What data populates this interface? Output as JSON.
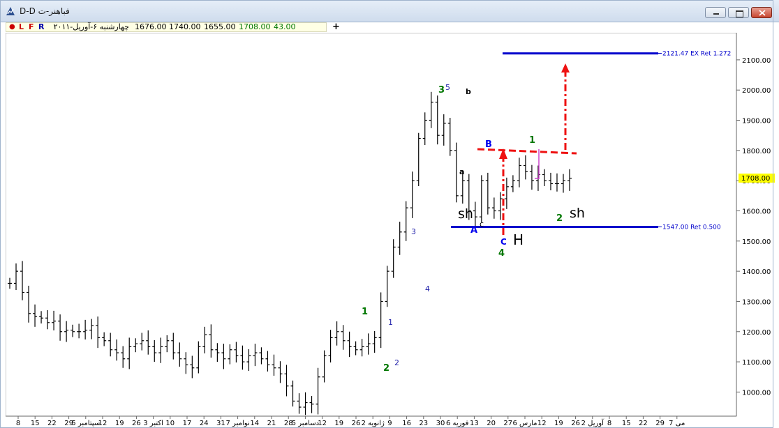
{
  "window": {
    "title": "D-D فباهنر-ت",
    "minimize_label": "minimize",
    "maximize_label": "maximize",
    "close_label": "close"
  },
  "infobar": {
    "dot": "●",
    "btn_l": "L",
    "btn_f": "F",
    "btn_r": "R",
    "date": "چهارشنبه ۶-آوریل-۲۰۱۱",
    "open": "1676.00",
    "high": "1740.00",
    "low": "1655.00",
    "close": "1708.00",
    "change": "43.00",
    "add": "+"
  },
  "chart_data": {
    "type": "ohlc",
    "y_axis": {
      "position": "right",
      "range": [
        950,
        2200
      ],
      "ticks": [
        "1000.00",
        "1100.00",
        "1200.00",
        "1300.00",
        "1400.00",
        "1500.00",
        "1600.00",
        "1700.00",
        "1800.00",
        "1900.00",
        "2000.00",
        "2100.00"
      ],
      "last_value": "1708.00"
    },
    "x_axis": {
      "labels": [
        "8",
        "15",
        "22",
        "29",
        "سپتامبر 5",
        "12",
        "19",
        "26",
        "اکتبر 3",
        "10",
        "17",
        "24",
        "31",
        "نوامبر 7",
        "14",
        "21",
        "28",
        "دسامبر 5",
        "12",
        "19",
        "26",
        "ژانویه 2",
        "9",
        "16",
        "23",
        "30",
        "فوریه 6",
        "13",
        "20",
        "27",
        "مارس 6",
        "12",
        "19",
        "26",
        "آوریل 2",
        "8",
        "15",
        "22",
        "29",
        "می 7"
      ]
    },
    "close_series": [
      1360,
      1400,
      1330,
      1260,
      1250,
      1245,
      1230,
      1235,
      1200,
      1205,
      1200,
      1200,
      1205,
      1220,
      1180,
      1170,
      1140,
      1130,
      1110,
      1150,
      1160,
      1170,
      1150,
      1130,
      1150,
      1170,
      1130,
      1110,
      1090,
      1080,
      1150,
      1190,
      1140,
      1130,
      1110,
      1140,
      1120,
      1100,
      1120,
      1130,
      1110,
      1090,
      1080,
      1060,
      1020,
      970,
      950,
      965,
      960,
      1050,
      1120,
      1180,
      1200,
      1170,
      1150,
      1140,
      1150,
      1160,
      1180,
      1300,
      1400,
      1480,
      1530,
      1610,
      1700,
      1840,
      1900,
      1960,
      1850,
      1890,
      1800,
      1650,
      1700,
      1600,
      1580,
      1700,
      1610,
      1600,
      1640,
      1680,
      1700,
      1750,
      1730,
      1700,
      1720,
      1700,
      1690,
      1690,
      1700,
      1708
    ],
    "levels": [
      {
        "value": 2121.47,
        "label": "2121.47 EX Ret 1.272",
        "color": "#0000cc"
      },
      {
        "value": 1547.0,
        "label": "1547.00 Ret 0.500",
        "color": "#0000cc"
      }
    ],
    "annotations": {
      "green": [
        "1",
        "2",
        "3",
        "4",
        "1",
        "2"
      ],
      "navy": [
        "1",
        "2",
        "3",
        "4",
        "5"
      ],
      "blue": [
        "B",
        "A",
        "C"
      ],
      "black": [
        "b",
        "a",
        "c",
        "sh",
        "sh",
        "H"
      ]
    },
    "colors": {
      "bars": "#000000",
      "level": "#0000cc",
      "arrow": "#ee1111",
      "highlight": "#ffff00",
      "wave_green": "#007700",
      "wave_navy": "#2222aa",
      "wave_blue": "#0000ee",
      "magenta": "#cc44cc"
    }
  }
}
